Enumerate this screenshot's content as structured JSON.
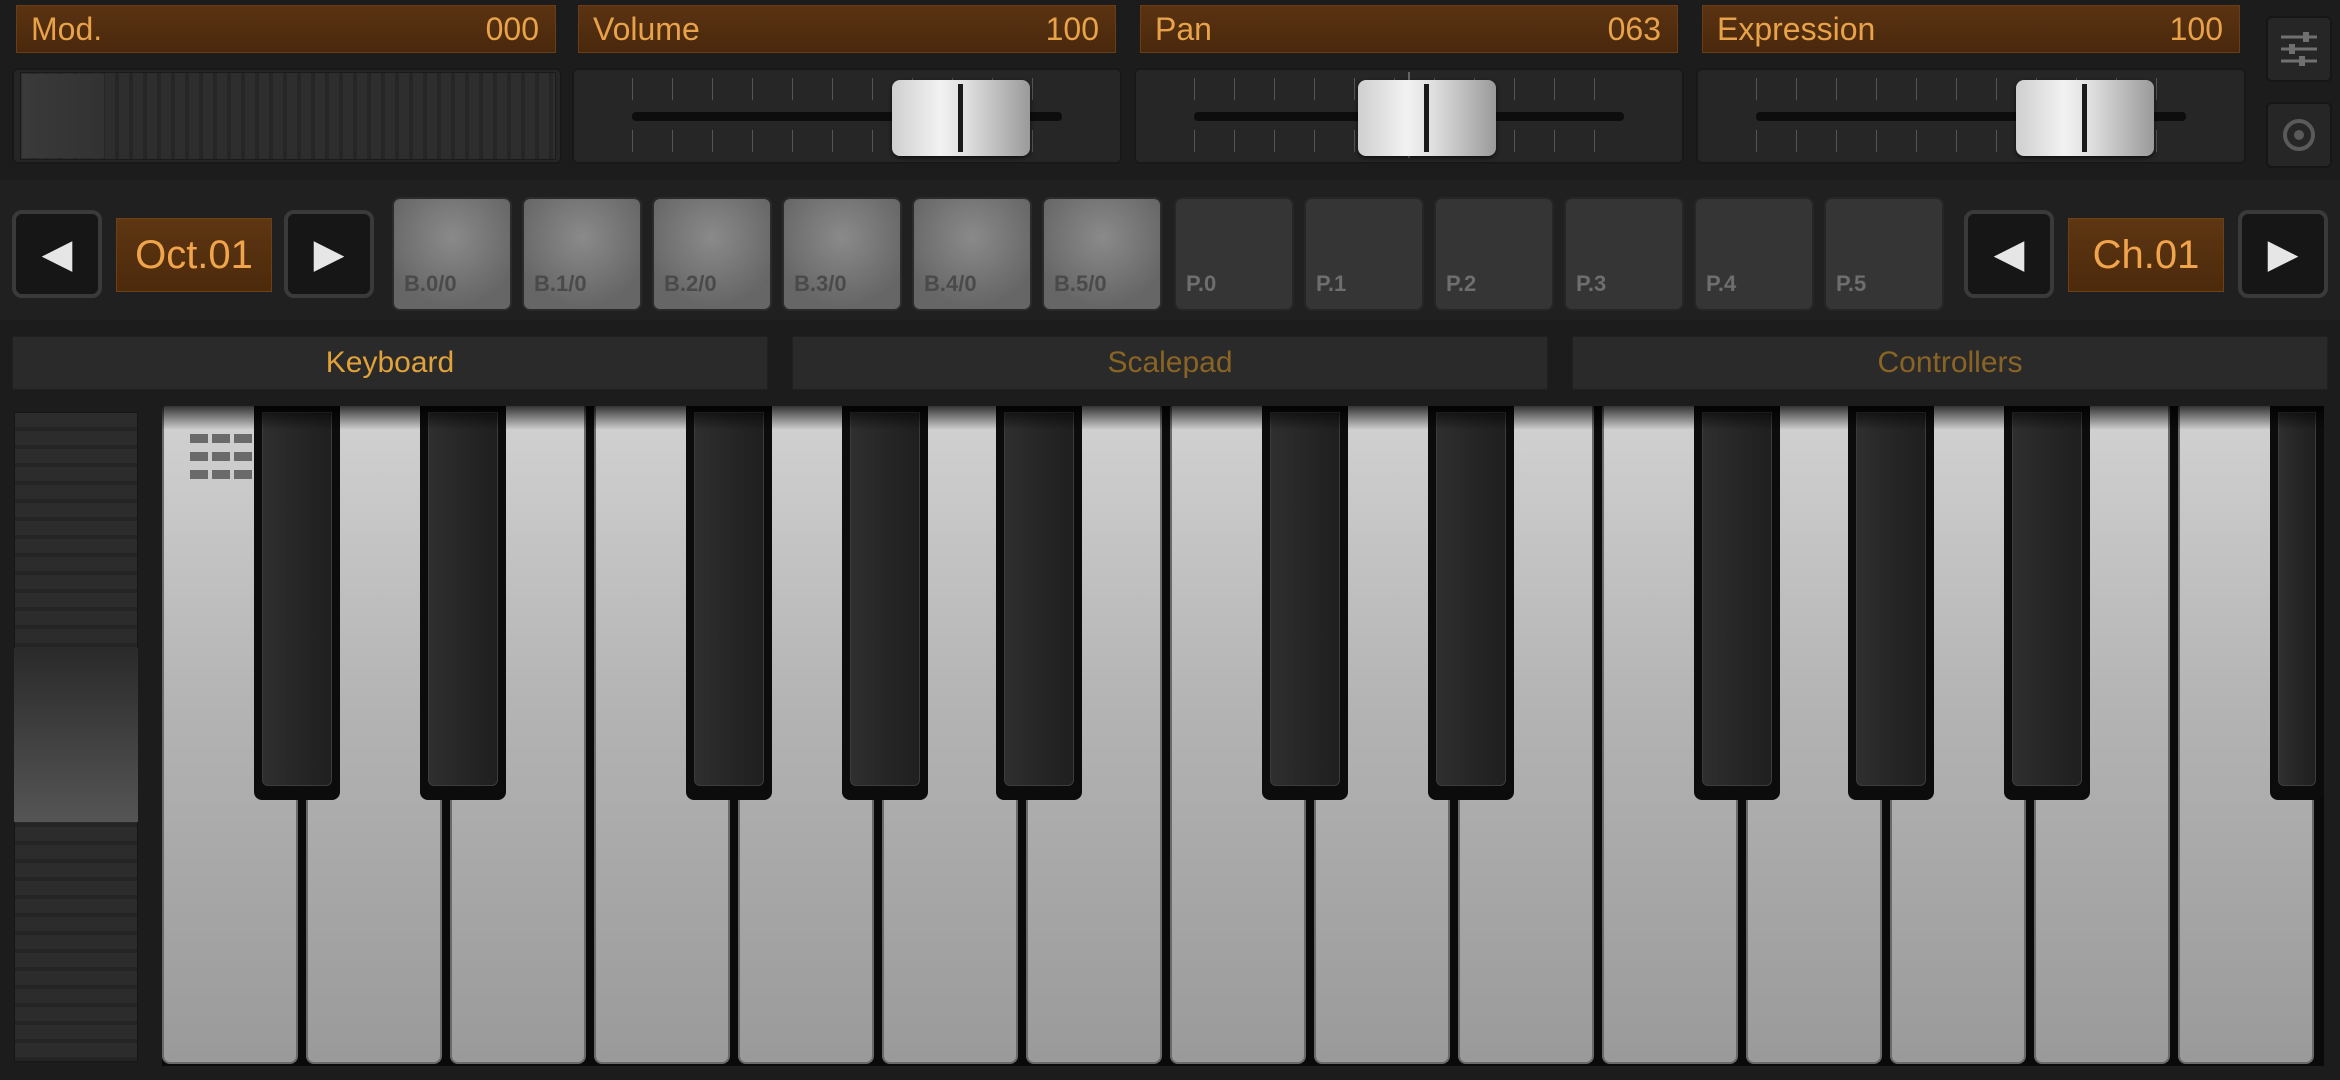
{
  "controllers": [
    {
      "label": "Mod.",
      "value": "000"
    },
    {
      "label": "Volume",
      "value": "100"
    },
    {
      "label": "Pan",
      "value": "063"
    },
    {
      "label": "Expression",
      "value": "100"
    }
  ],
  "slider_levels": {
    "volume": 100,
    "pan": 63,
    "expression": 100,
    "max": 127
  },
  "side_buttons": {
    "settings_icon": "sliders-icon",
    "record_icon": "target-icon"
  },
  "octave": {
    "prev_label": "◀",
    "value": "Oct.01",
    "next_label": "▶"
  },
  "channel": {
    "prev_label": "◀",
    "value": "Ch.01",
    "next_label": "▶"
  },
  "pads": [
    {
      "label": "B.0/0",
      "kind": "bank"
    },
    {
      "label": "B.1/0",
      "kind": "bank"
    },
    {
      "label": "B.2/0",
      "kind": "bank"
    },
    {
      "label": "B.3/0",
      "kind": "bank"
    },
    {
      "label": "B.4/0",
      "kind": "bank"
    },
    {
      "label": "B.5/0",
      "kind": "bank"
    },
    {
      "label": "P.0",
      "kind": "prog"
    },
    {
      "label": "P.1",
      "kind": "prog"
    },
    {
      "label": "P.2",
      "kind": "prog"
    },
    {
      "label": "P.3",
      "kind": "prog"
    },
    {
      "label": "P.4",
      "kind": "prog"
    },
    {
      "label": "P.5",
      "kind": "prog"
    }
  ],
  "tabs": [
    {
      "label": "Keyboard",
      "active": true
    },
    {
      "label": "Scalepad",
      "active": false
    },
    {
      "label": "Controllers",
      "active": false
    }
  ],
  "keyboard": {
    "white_keys": 15,
    "black_keys": 11,
    "first_note": "C"
  },
  "colors": {
    "accent": "#e7a24a",
    "lcd_bg": "#5a3312",
    "background": "#1c1c1c"
  }
}
